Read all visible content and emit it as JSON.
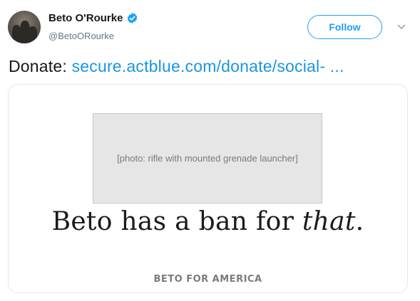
{
  "author": {
    "name": "Beto O'Rourke",
    "handle": "@BetoORourke",
    "verified": true
  },
  "actions": {
    "follow_label": "Follow"
  },
  "tweet": {
    "prefix": "Donate:",
    "link_text": "secure.actblue.com/donate/social-  ..."
  },
  "card": {
    "image_alt": "[photo: rifle with mounted grenade launcher]",
    "headline_part1": "Beto has a ban for ",
    "headline_emphasis": "that",
    "headline_end": ".",
    "footer_brand": "BETO FOR AMERICA"
  },
  "colors": {
    "accent": "#1da1f2",
    "link": "#1b95e0",
    "text": "#14171a",
    "muted": "#657786"
  }
}
